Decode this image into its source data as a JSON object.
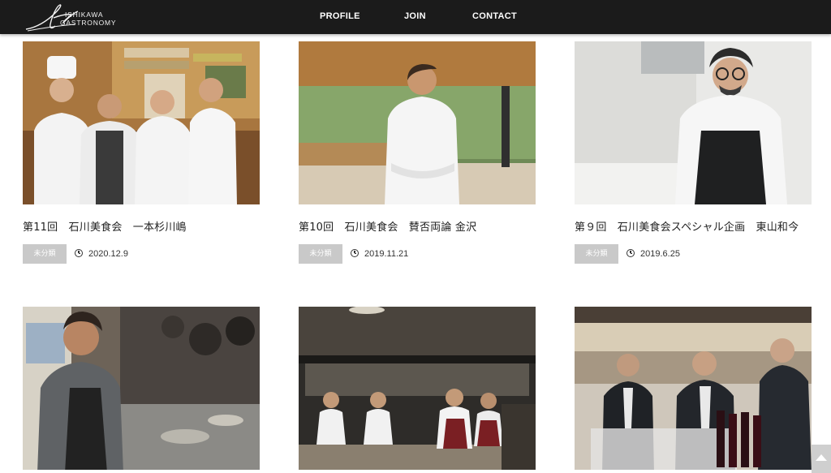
{
  "header": {
    "logo_line1": "ISHIKAWA",
    "logo_line2": "GASTRONOMY",
    "nav": [
      {
        "label": "PROFILE"
      },
      {
        "label": "JOIN"
      },
      {
        "label": "CONTACT"
      }
    ]
  },
  "posts": [
    {
      "title": "第11回　石川美食会　一本杉川嶋",
      "category": "未分類",
      "date": "2020.12.9",
      "photo": "four chefs in white coats at a shop counter"
    },
    {
      "title": "第10回　石川美食会　賛否両論 金沢",
      "category": "未分類",
      "date": "2019.11.21",
      "photo": "chef in white coat with arms crossed at a counter"
    },
    {
      "title": "第９回　石川美食会スペシャル企画　東山和今",
      "category": "未分類",
      "date": "2019.6.25",
      "photo": "chef with glasses and black apron"
    },
    {
      "title": "",
      "category": "",
      "date": "",
      "photo": "chef cooking at a stove with pans"
    },
    {
      "title": "",
      "category": "",
      "date": "",
      "photo": "open kitchen with cooks working"
    },
    {
      "title": "",
      "category": "",
      "date": "",
      "photo": "men in suits with wine glasses and bottles"
    }
  ],
  "colors": {
    "header_bg": "#1b1b1b",
    "badge_bg": "#c9c9c9"
  }
}
